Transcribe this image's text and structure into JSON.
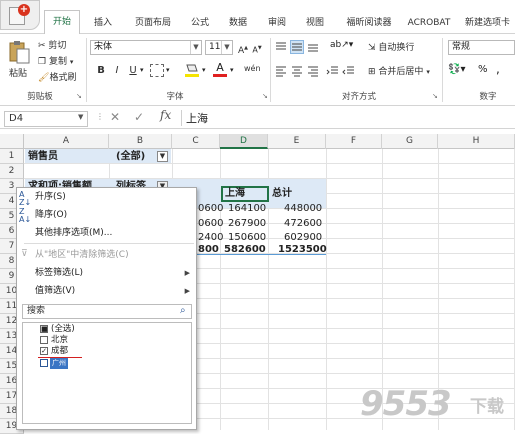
{
  "tabs": [
    "开始",
    "插入",
    "页面布局",
    "公式",
    "数据",
    "审阅",
    "视图",
    "福昕阅读器",
    "ACROBAT",
    "新建选项卡"
  ],
  "ribbon": {
    "paste": "粘贴",
    "cut": "剪切",
    "copy": "复制",
    "format_painter": "格式刷",
    "font_name": "宋体",
    "font_size": "11",
    "bold": "B",
    "italic": "I",
    "underline": "U",
    "wrap_text": "自动换行",
    "merge_center": "合并后居中",
    "number_format": "常规",
    "percent": "%",
    "comma": ",",
    "groups": {
      "clipboard": "剪贴板",
      "font": "字体",
      "alignment": "对齐方式",
      "number": "数字"
    }
  },
  "formula_bar": {
    "name_box": "D4",
    "fx": "fx",
    "value": "上海"
  },
  "columns": [
    "A",
    "B",
    "C",
    "D",
    "E",
    "F",
    "G",
    "H"
  ],
  "rows": [
    "1",
    "2",
    "3",
    "4",
    "5",
    "6",
    "7",
    "8",
    "9",
    "10",
    "11",
    "12",
    "13",
    "14",
    "15",
    "16",
    "17",
    "18",
    "19"
  ],
  "cells": {
    "a1": "销售员",
    "b1": "(全部)",
    "a3": "求和项:销售额",
    "b3": "列标签",
    "d3": "上海",
    "e3": "总计",
    "c4": "0600",
    "d4": "164100",
    "e4": "448000",
    "c5": "0600",
    "d5": "267900",
    "e5": "472600",
    "c6": "2400",
    "d6": "150600",
    "e6": "602900",
    "c7": "800",
    "d7": "582600",
    "e7": "1523500"
  },
  "menu": {
    "sort_asc": "升序(S)",
    "sort_desc": "降序(O)",
    "more_sort": "其他排序选项(M)...",
    "clear_filter": "从\"地区\"中清除筛选(C)",
    "label_filter": "标签筛选(L)",
    "value_filter": "值筛选(V)",
    "search_placeholder": "搜索",
    "items": [
      "(全选)",
      "北京",
      "成都",
      "广州"
    ]
  },
  "watermark": {
    "num": "9553",
    "dl": "下载"
  }
}
